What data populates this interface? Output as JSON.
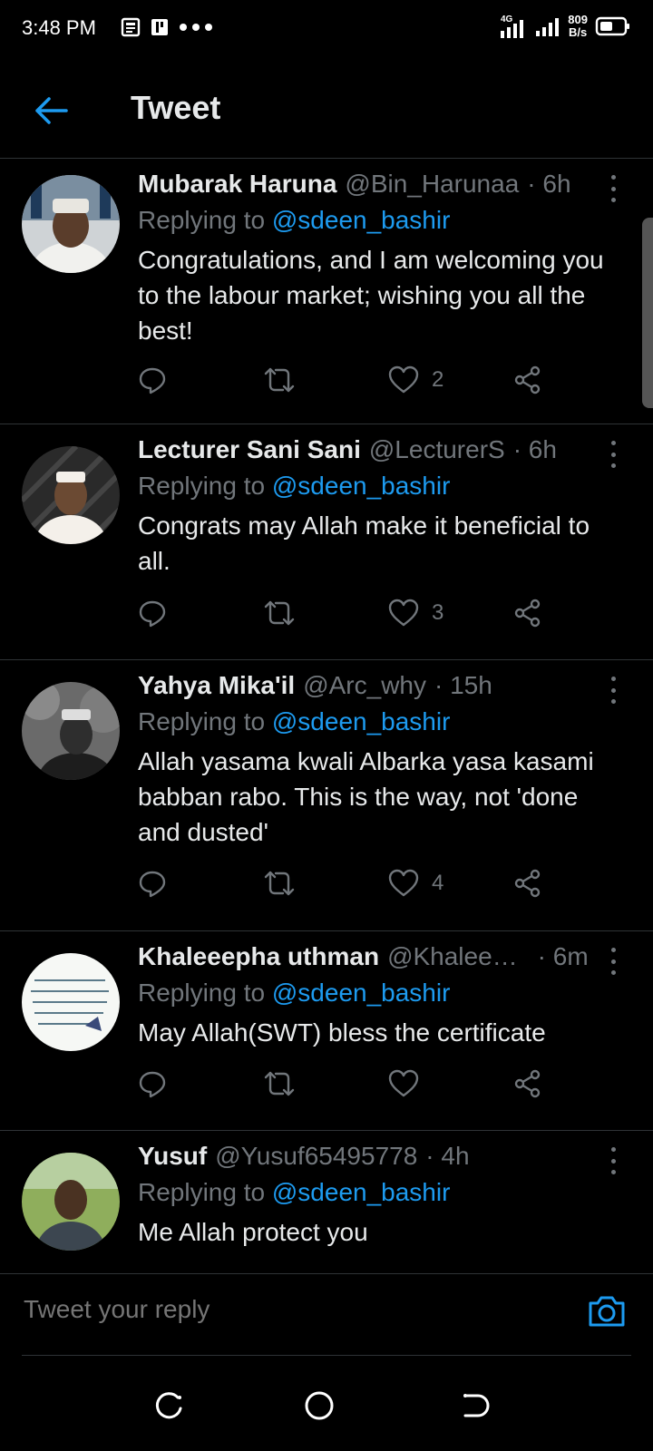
{
  "status_bar": {
    "time": "3:48 PM",
    "net_speed_value": "809",
    "net_speed_unit": "B/s",
    "network_label": "4G"
  },
  "header": {
    "title": "Tweet"
  },
  "tweets": [
    {
      "name": "Mubarak Haruna",
      "handle": "@Bin_Harunaa",
      "time": "· 6h",
      "replying_label": "Replying to",
      "mention": "@sdeen_bashir",
      "text": "Congratulations, and I am welcoming you to the labour market; wishing you all the best!",
      "likes": "2"
    },
    {
      "name": "Lecturer Sani Sani",
      "handle": "@LecturerS",
      "time": "· 6h",
      "replying_label": "Replying to",
      "mention": "@sdeen_bashir",
      "text": "Congrats may Allah make it beneficial to all.",
      "likes": "3"
    },
    {
      "name": "Yahya Mika'il",
      "handle": "@Arc_why",
      "time": "· 15h",
      "replying_label": "Replying to",
      "mention": "@sdeen_bashir",
      "text": "Allah yasama kwali Albarka yasa kasami babban rabo. This is the way, not 'done and dusted'",
      "likes": "4"
    },
    {
      "name": "Khaleeepha uthman",
      "handle": "@Khalee…",
      "time": "· 6m",
      "replying_label": "Replying to",
      "mention": "@sdeen_bashir",
      "text": "May Allah(SWT)  bless the certificate",
      "likes": ""
    },
    {
      "name": "Yusuf",
      "handle": "@Yusuf65495778",
      "time": "· 4h",
      "replying_label": "Replying to",
      "mention": "@sdeen_bashir",
      "text": "Me Allah protect you",
      "likes": ""
    }
  ],
  "reply_bar": {
    "placeholder": "Tweet your reply"
  },
  "colors": {
    "accent": "#1d9bf0",
    "background": "#000000",
    "muted": "#71767b",
    "divider": "#2f3336"
  },
  "icons": {
    "back": "arrow-left-icon",
    "more": "more-vertical-icon",
    "reply": "reply-icon",
    "retweet": "retweet-icon",
    "like": "heart-icon",
    "share": "share-icon",
    "camera": "camera-icon"
  }
}
